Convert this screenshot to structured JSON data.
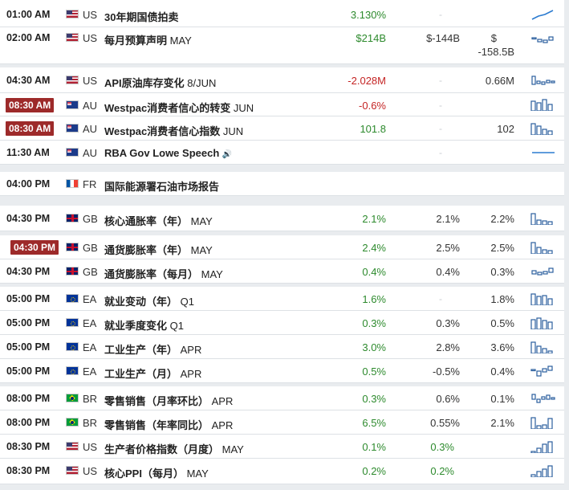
{
  "rows": [
    {
      "time": "01:00 AM",
      "cc": "US",
      "flag": "us",
      "event": "30年期国债拍卖",
      "month": "",
      "actual": "3.130%",
      "tone": "g",
      "forecast": "-",
      "previous": "",
      "spark": "line"
    },
    {
      "time": "02:00 AM",
      "cc": "US",
      "flag": "us",
      "event": "每月预算声明",
      "month": "MAY",
      "actual": "$214B",
      "tone": "g",
      "forecast": "$-144B",
      "previous_top": "$",
      "previous": "-158.5B",
      "spark": "small"
    },
    {
      "time": "04:30 AM",
      "cc": "US",
      "flag": "us",
      "event": "API原油库存变化",
      "month": "8/JUN",
      "actual": "-2.028M",
      "tone": "r",
      "forecast": "-",
      "previous": "0.66M",
      "spark": "small"
    },
    {
      "time": "08:30 AM",
      "cc": "AU",
      "flag": "au",
      "event": "Westpac消费者信心的转变",
      "month": "JUN",
      "actual": "-0.6%",
      "tone": "r",
      "forecast": "-",
      "previous": "",
      "spark": "bars",
      "highlight": true
    },
    {
      "time": "08:30 AM",
      "cc": "AU",
      "flag": "au",
      "event": "Westpac消费者信心指数",
      "month": "JUN",
      "actual": "101.8",
      "tone": "g",
      "forecast": "-",
      "previous": "102",
      "spark": "bars",
      "highlight": true
    },
    {
      "time": "11:30 AM",
      "cc": "AU",
      "flag": "au",
      "event": "RBA Gov Lowe Speech",
      "month": "",
      "speaker": "🔊",
      "actual": "",
      "tone": "g",
      "forecast": "-",
      "previous": "",
      "spark": "flat"
    },
    {
      "time": "04:00 PM",
      "cc": "FR",
      "flag": "fr",
      "event": "国际能源署石油市场报告",
      "month": "",
      "actual": "",
      "tone": "g",
      "forecast": "",
      "previous": "",
      "spark": "none"
    },
    {
      "time": "04:30 PM",
      "cc": "GB",
      "flag": "gb",
      "event": "核心通胀率（年）",
      "month": "MAY",
      "actual": "2.1%",
      "tone": "g",
      "forecast": "2.1%",
      "previous": "2.2%",
      "spark": "bars"
    },
    {
      "time": "04:30 PM",
      "cc": "GB",
      "flag": "gb",
      "event": "通货膨胀率（年）",
      "month": "MAY",
      "actual": "2.4%",
      "tone": "g",
      "forecast": "2.5%",
      "previous": "2.5%",
      "spark": "bars",
      "highlight": true
    },
    {
      "time": "04:30 PM",
      "cc": "GB",
      "flag": "gb",
      "event": "通货膨胀率（每月）",
      "month": "MAY",
      "actual": "0.4%",
      "tone": "g",
      "forecast": "0.4%",
      "previous": "0.3%",
      "spark": "small"
    },
    {
      "time": "05:00 PM",
      "cc": "EA",
      "flag": "eu",
      "event": "就业变动（年）",
      "month": "Q1",
      "actual": "1.6%",
      "tone": "g",
      "forecast": "-",
      "previous": "1.8%",
      "spark": "bars"
    },
    {
      "time": "05:00 PM",
      "cc": "EA",
      "flag": "eu",
      "event": "就业季度变化",
      "month": "Q1",
      "actual": "0.3%",
      "tone": "g",
      "forecast": "0.3%",
      "previous": "0.5%",
      "spark": "bars"
    },
    {
      "time": "05:00 PM",
      "cc": "EA",
      "flag": "eu",
      "event": "工业生产（年）",
      "month": "APR",
      "actual": "3.0%",
      "tone": "g",
      "forecast": "2.8%",
      "previous": "3.6%",
      "spark": "bars"
    },
    {
      "time": "05:00 PM",
      "cc": "EA",
      "flag": "eu",
      "event": "工业生产（月）",
      "month": "APR",
      "actual": "0.5%",
      "tone": "g",
      "forecast": "-0.5%",
      "previous": "0.4%",
      "spark": "small"
    },
    {
      "time": "08:00 PM",
      "cc": "BR",
      "flag": "br",
      "event": "零售销售（月率环比）",
      "month": "APR",
      "actual": "0.3%",
      "tone": "g",
      "forecast": "0.6%",
      "previous": "0.1%",
      "spark": "small"
    },
    {
      "time": "08:00 PM",
      "cc": "BR",
      "flag": "br",
      "event": "零售销售（年率同比）",
      "month": "APR",
      "actual": "6.5%",
      "tone": "g",
      "forecast": "0.55%",
      "previous": "2.1%",
      "spark": "bars"
    },
    {
      "time": "08:30 PM",
      "cc": "US",
      "flag": "us",
      "event": "生产者价格指数（月度）",
      "month": "MAY",
      "actual": "0.1%",
      "tone": "g",
      "forecast": "0.3%",
      "tone_fc": "g",
      "previous": "",
      "spark": "bars"
    },
    {
      "time": "08:30 PM",
      "cc": "US",
      "flag": "us",
      "event": "核心PPI（每月）",
      "month": "MAY",
      "actual": "0.2%",
      "tone": "g",
      "forecast": "0.2%",
      "tone_fc": "g",
      "previous": "",
      "spark": "bars"
    }
  ],
  "colors": {
    "positive": "#2d8a2d",
    "negative": "#c42424",
    "highlight_badge": "#9d2a2a"
  }
}
